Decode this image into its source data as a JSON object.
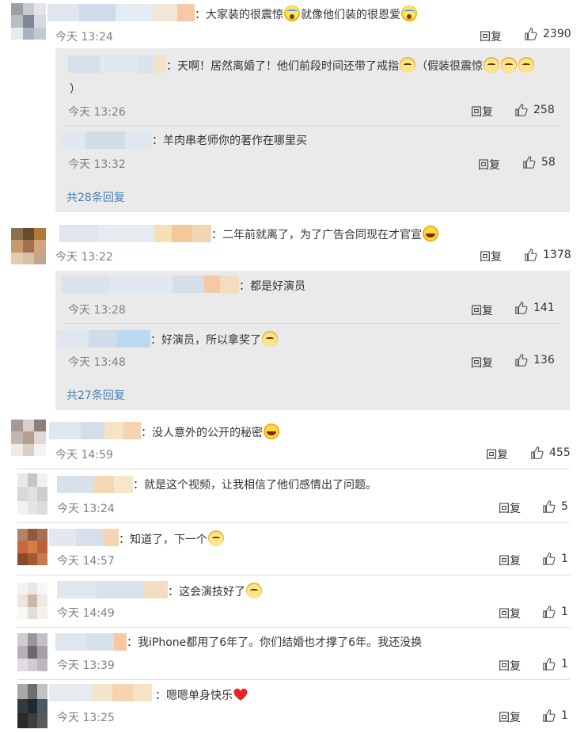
{
  "comments": [
    {
      "text": "：大家装的很震惊",
      "text2": "就像他们装的很恩爱",
      "time": "今天 13:24",
      "reply": "回复",
      "likes": "2390"
    },
    {
      "text": "：二年前就离了，为了广告合同现在才官宣",
      "time": "今天 13:22",
      "reply": "回复",
      "likes": "1378"
    },
    {
      "text": "：没人意外的公开的秘密",
      "time": "今天 14:59",
      "reply": "回复",
      "likes": "455"
    },
    {
      "text": "：就是这个视频，让我相信了他们感情出了问题。",
      "time": "今天 13:24",
      "reply": "回复",
      "likes": "5"
    },
    {
      "text": "：知道了，下一个",
      "time": "今天 14:57",
      "reply": "回复",
      "likes": "1"
    },
    {
      "text": "：这会演技好了",
      "time": "今天 14:49",
      "reply": "回复",
      "likes": "1"
    },
    {
      "text": "：我iPhone都用了6年了。你们结婚也才撑了6年。我还没换",
      "time": "今天 13:39",
      "reply": "回复",
      "likes": "1"
    },
    {
      "text": "：嗯嗯单身快乐",
      "time": "今天 13:25",
      "reply": "回复",
      "likes": "1"
    }
  ],
  "subreplies": [
    {
      "text": "：天啊！居然离婚了！他们前段时间还带了戒指",
      "text2": "（假装很震惊",
      "text3": "）",
      "time": "今天 13:26",
      "reply": "回复",
      "likes": "258"
    },
    {
      "text": "：羊肉串老师你的著作在哪里买",
      "time": "今天 13:32",
      "reply": "回复",
      "likes": "58"
    },
    {
      "text": "：都是好演员",
      "time": "今天 13:28",
      "reply": "回复",
      "likes": "141"
    },
    {
      "text": "：好演员，所以拿奖了",
      "time": "今天 13:48",
      "reply": "回复",
      "likes": "136"
    }
  ],
  "more": [
    "共28条回复",
    "共27条回复"
  ],
  "icons": {
    "like": "thumbs-up-icon"
  },
  "colors": {
    "link": "#4a7fb5",
    "panel": "#eaeaea",
    "time": "#808080"
  }
}
